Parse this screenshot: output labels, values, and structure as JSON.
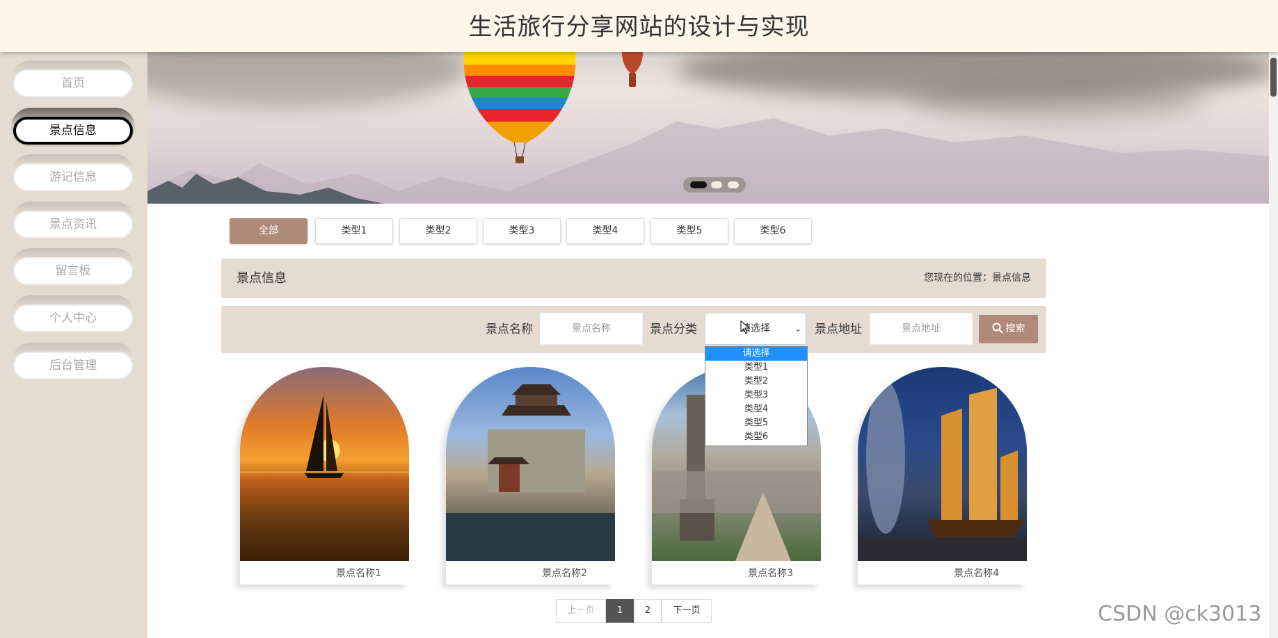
{
  "header": {
    "title": "生活旅行分享网站的设计与实现"
  },
  "sidebar": {
    "items": [
      {
        "label": "首页",
        "active": false
      },
      {
        "label": "景点信息",
        "active": true
      },
      {
        "label": "游记信息",
        "active": false
      },
      {
        "label": "景点资讯",
        "active": false
      },
      {
        "label": "留言板",
        "active": false
      },
      {
        "label": "个人中心",
        "active": false
      },
      {
        "label": "后台管理",
        "active": false
      }
    ]
  },
  "banner": {
    "slides": 3,
    "active_slide": 1
  },
  "tabs": [
    "全部",
    "类型1",
    "类型2",
    "类型3",
    "类型4",
    "类型5",
    "类型6"
  ],
  "titlebar": {
    "title": "景点信息",
    "location": "您现在的位置：景点信息"
  },
  "search": {
    "name_label": "景点名称",
    "name_placeholder": "景点名称",
    "category_label": "景点分类",
    "category_value": "请选择",
    "address_label": "景点地址",
    "address_placeholder": "景点地址",
    "button": "搜索"
  },
  "dropdown": {
    "options": [
      "请选择",
      "类型1",
      "类型2",
      "类型3",
      "类型4",
      "类型5",
      "类型6"
    ],
    "highlighted": "请选择"
  },
  "cards": [
    {
      "name": "景点名称1",
      "image": "sailboat-sunset"
    },
    {
      "name": "景点名称2",
      "image": "pagoda-lake"
    },
    {
      "name": "景点名称3",
      "image": "city-monument"
    },
    {
      "name": "景点名称4",
      "image": "junk-boat-night"
    }
  ],
  "pagination": {
    "prev": "上一页",
    "pages": [
      "1",
      "2"
    ],
    "current": "1",
    "next": "下一页"
  },
  "watermark": "CSDN @ck3013",
  "colors": {
    "accent": "#b08a78",
    "panel": "#e6dbd0",
    "header_bg": "#fdf6e9",
    "sidebar_bg": "#e6dbd0"
  }
}
